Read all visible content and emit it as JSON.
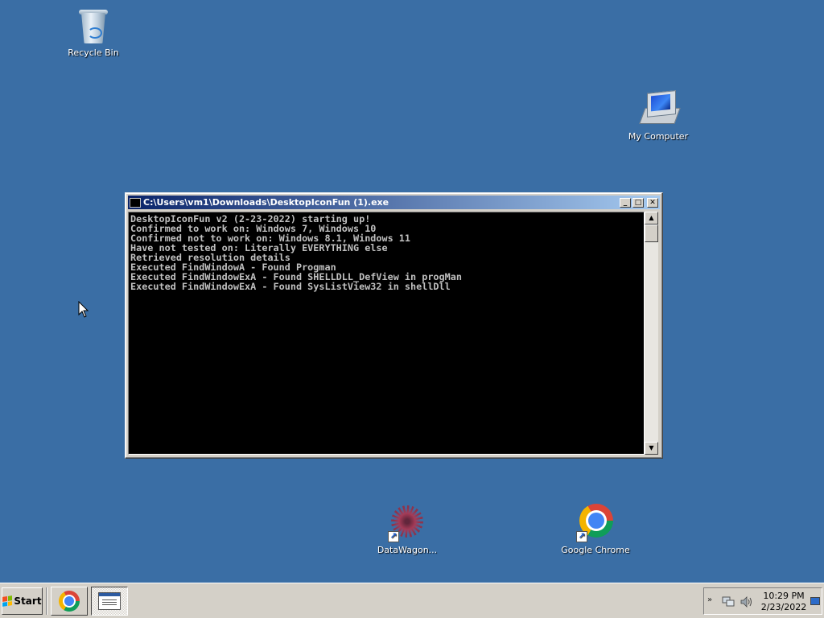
{
  "desktop": {
    "icons": [
      {
        "label": "Recycle Bin",
        "icon": "recycle-bin-icon"
      },
      {
        "label": "My Computer",
        "icon": "computer-icon"
      },
      {
        "label": "DataWagon...",
        "icon": "datawagon-icon"
      },
      {
        "label": "Google Chrome",
        "icon": "chrome-icon"
      }
    ],
    "background_color": "#3a6ea5"
  },
  "console_window": {
    "title": "C:\\Users\\vm1\\Downloads\\DesktopIconFun (1).exe",
    "minimize_label": "_",
    "maximize_label": "□",
    "close_label": "✕",
    "lines": [
      "DesktopIconFun v2 (2-23-2022) starting up!",
      "Confirmed to work on: Windows 7, Windows 10",
      "Confirmed not to work on: Windows 8.1, Windows 11",
      "Have not tested on: Literally EVERYTHING else",
      "Retrieved resolution details",
      "Executed FindWindowA - Found Progman",
      "Executed FindWindowExA - Found SHELLDLL_DefView in progMan",
      "Executed FindWindowExA - Found SysListView32 in shellDll"
    ],
    "scroll_up_label": "▲",
    "scroll_down_label": "▼"
  },
  "taskbar": {
    "start_label": "Start",
    "apps": [
      {
        "name": "Google Chrome",
        "icon": "chrome-icon"
      },
      {
        "name": "DesktopIconFun console",
        "icon": "console-icon"
      }
    ],
    "tray": {
      "expand_label": "»",
      "time": "10:29 PM",
      "date": "2/23/2022"
    }
  }
}
